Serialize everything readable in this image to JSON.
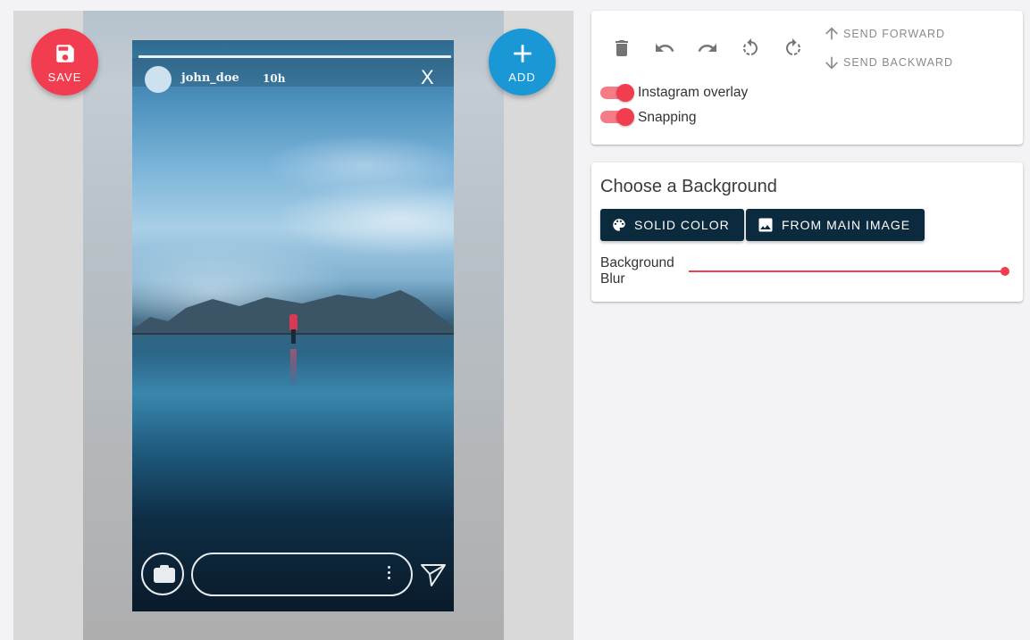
{
  "fabs": {
    "save_label": "SAVE",
    "add_label": "ADD"
  },
  "story": {
    "username": "john_doe",
    "time": "10h",
    "close": "X"
  },
  "toolbar": {
    "icons": [
      "delete-icon",
      "undo-icon",
      "redo-icon",
      "rotate-left-icon",
      "rotate-right-icon"
    ],
    "send_forward": "SEND FORWARD",
    "send_backward": "SEND BACKWARD"
  },
  "toggles": {
    "instagram_overlay": {
      "label": "Instagram overlay",
      "on": true
    },
    "snapping": {
      "label": "Snapping",
      "on": true
    }
  },
  "background_panel": {
    "title": "Choose a Background",
    "solid_color": "SOLID COLOR",
    "from_main_image": "FROM MAIN IMAGE",
    "blur_label": "Background Blur",
    "blur_value": 1.0
  },
  "colors": {
    "accent_red": "#f23c4f",
    "accent_blue": "#1a98d5",
    "dark_button": "#0c2a3e"
  }
}
